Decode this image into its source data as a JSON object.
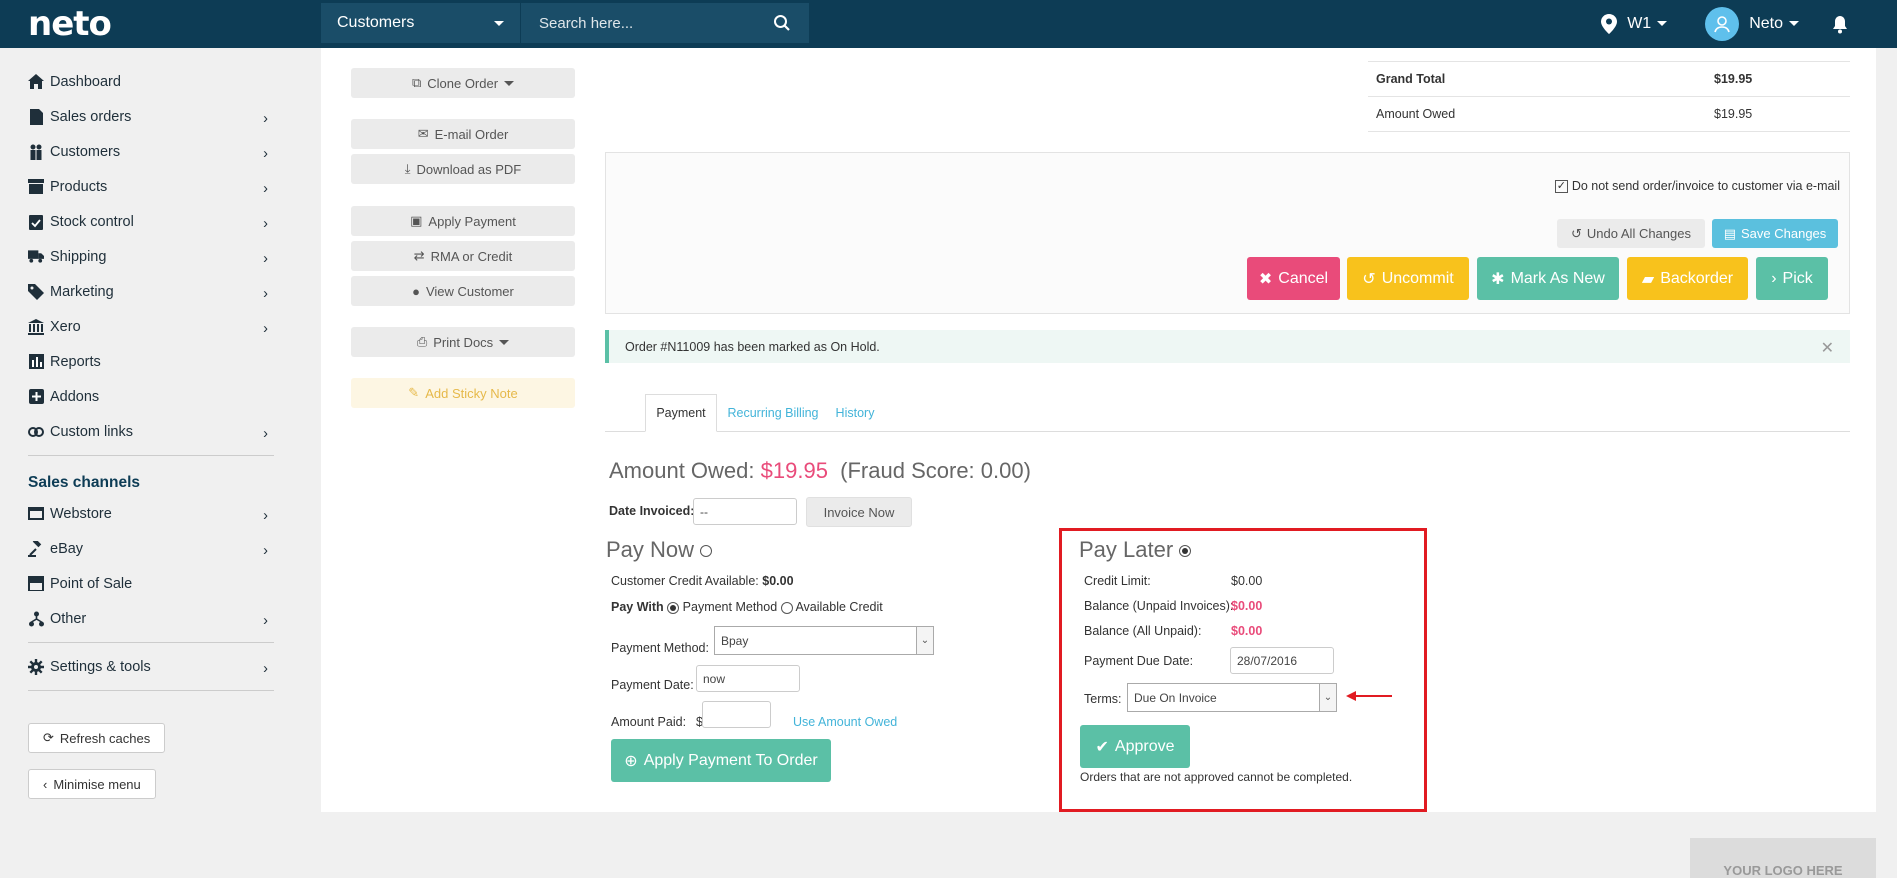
{
  "app": {
    "logo": "neto"
  },
  "topbar": {
    "search_scope": "Customers",
    "search_placeholder": "Search here...",
    "location": "W1",
    "user": "Neto"
  },
  "sidebar": {
    "items": [
      {
        "label": "Dashboard",
        "icon": "home-icon"
      },
      {
        "label": "Sales orders",
        "icon": "document-icon"
      },
      {
        "label": "Customers",
        "icon": "people-icon"
      },
      {
        "label": "Products",
        "icon": "box-icon"
      },
      {
        "label": "Stock control",
        "icon": "clipboard-check-icon"
      },
      {
        "label": "Shipping",
        "icon": "truck-icon"
      },
      {
        "label": "Marketing",
        "icon": "tag-icon"
      },
      {
        "label": "Xero",
        "icon": "bank-icon"
      },
      {
        "label": "Reports",
        "icon": "bar-chart-icon"
      },
      {
        "label": "Addons",
        "icon": "plus-square-icon"
      },
      {
        "label": "Custom links",
        "icon": "link-icon"
      }
    ],
    "channels_heading": "Sales channels",
    "channels": [
      {
        "label": "Webstore",
        "icon": "window-icon"
      },
      {
        "label": "eBay",
        "icon": "gavel-icon"
      },
      {
        "label": "Point of Sale",
        "icon": "store-icon"
      },
      {
        "label": "Other",
        "icon": "network-icon"
      }
    ],
    "settings": "Settings & tools",
    "refresh_caches": "Refresh caches",
    "minimise_menu": "Minimise menu"
  },
  "left_actions": {
    "clone_order": "Clone Order",
    "email_order": "E-mail Order",
    "download_pdf": "Download as PDF",
    "apply_payment": "Apply Payment",
    "rma_credit": "RMA or Credit",
    "view_customer": "View Customer",
    "print_docs": "Print Docs",
    "add_sticky_note": "Add Sticky Note"
  },
  "totals": {
    "grand_total_label": "Grand Total",
    "grand_total_value": "$19.95",
    "amount_owed_label": "Amount Owed",
    "amount_owed_value": "$19.95"
  },
  "actions": {
    "do_not_send": "Do not send order/invoice to customer via e-mail",
    "undo_all": "Undo All Changes",
    "save_changes": "Save Changes",
    "cancel": "Cancel",
    "uncommit": "Uncommit",
    "mark_as_new": "Mark As New",
    "backorder": "Backorder",
    "pick": "Pick"
  },
  "colors": {
    "cancel": "#e94b7a",
    "uncommit": "#f8c21c",
    "mark_as_new": "#5bc0a6",
    "backorder": "#f8c21c",
    "pick": "#5bc0a6",
    "save": "#5bc0de"
  },
  "alert": {
    "message": "Order #N11009 has been marked as On Hold."
  },
  "tabs": [
    {
      "label": "Payment"
    },
    {
      "label": "Recurring Billing"
    },
    {
      "label": "History"
    }
  ],
  "payment": {
    "amount_owed_label": "Amount Owed:",
    "amount_owed_value": "$19.95",
    "fraud_score": "(Fraud Score: 0.00)",
    "date_invoiced_label": "Date Invoiced:",
    "date_invoiced_value": "--",
    "invoice_now": "Invoice Now",
    "pay_now_heading": "Pay Now",
    "customer_credit_label": "Customer Credit Available:",
    "customer_credit_value": "$0.00",
    "pay_with_label": "Pay With",
    "pay_with_method": "Payment Method",
    "pay_with_credit": "Available Credit",
    "payment_method_label": "Payment Method:",
    "payment_method_value": "Bpay",
    "payment_date_label": "Payment Date:",
    "payment_date_value": "now",
    "amount_paid_label": "Amount Paid:",
    "currency_symbol": "$",
    "use_amount_owed": "Use Amount Owed",
    "apply_payment_to_order": "Apply Payment To Order"
  },
  "pay_later": {
    "heading": "Pay Later",
    "credit_limit_label": "Credit Limit:",
    "credit_limit_value": "$0.00",
    "balance_unpaid_label": "Balance (Unpaid Invoices):",
    "balance_unpaid_value": "$0.00",
    "balance_all_label": "Balance (All Unpaid):",
    "balance_all_value": "$0.00",
    "due_date_label": "Payment Due Date:",
    "due_date_value": "28/07/2016",
    "terms_label": "Terms:",
    "terms_value": "Due On Invoice",
    "approve": "Approve",
    "note": "Orders that are not approved cannot be completed."
  },
  "footer": {
    "logo_placeholder": "YOUR LOGO HERE"
  }
}
